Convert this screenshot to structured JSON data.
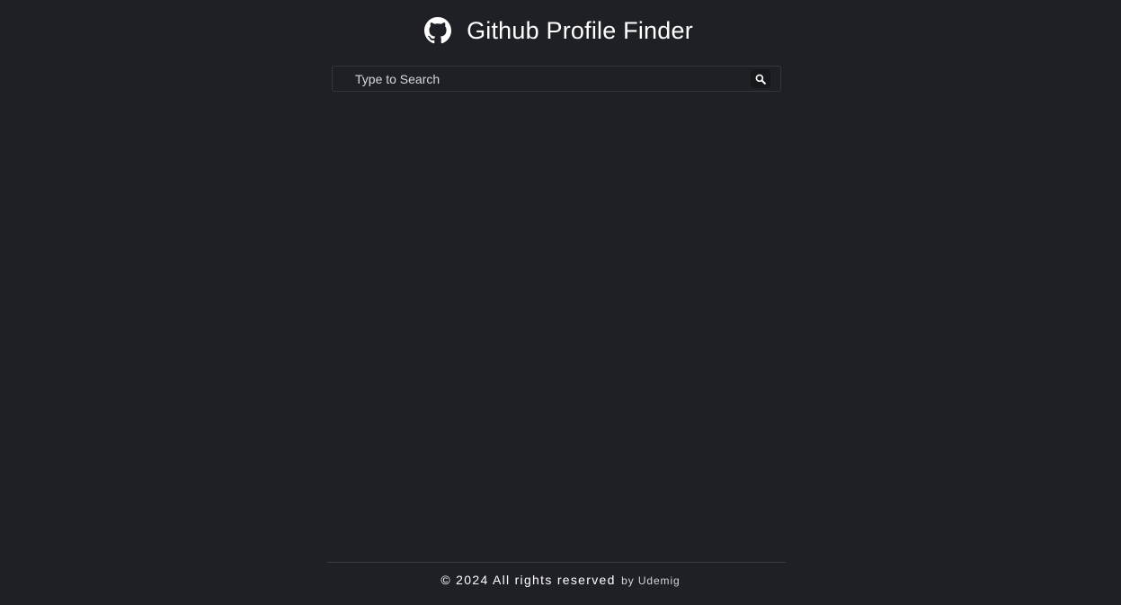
{
  "header": {
    "logo_icon": "github-icon",
    "title": "Github Profile Finder"
  },
  "search": {
    "placeholder": "Type to Search",
    "value": "",
    "button_icon": "search-icon"
  },
  "footer": {
    "copyright": "© 2024 All rights reserved",
    "by": "by Udemig"
  },
  "colors": {
    "background": "#1f2025",
    "text": "#ffffff",
    "border": "#34363d"
  }
}
